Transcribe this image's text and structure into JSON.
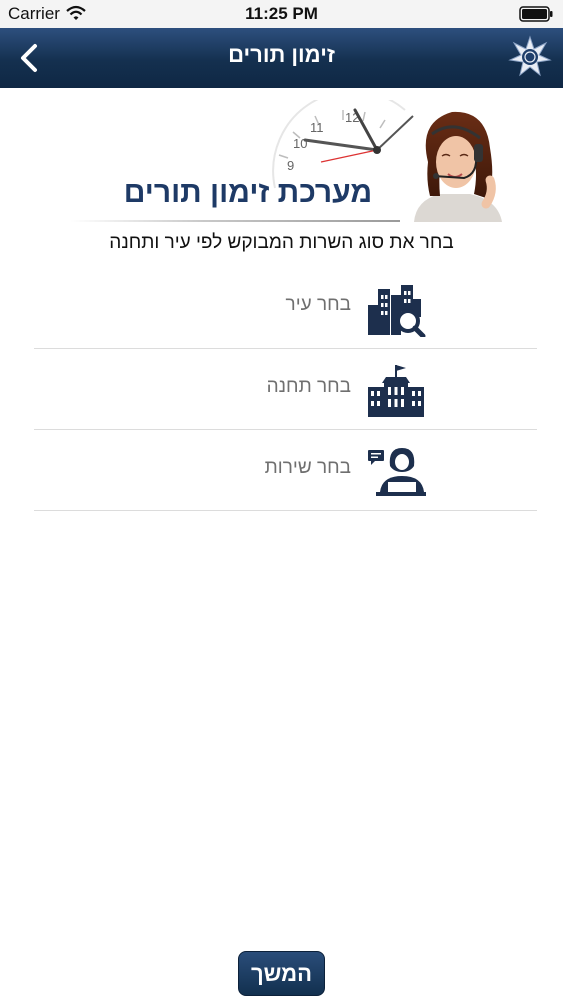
{
  "status_bar": {
    "carrier": "Carrier",
    "time": "11:25 PM"
  },
  "nav": {
    "title": "זימון תורים"
  },
  "banner": {
    "title": "מערכת זימון תורים",
    "clock_numbers": [
      "12",
      "11",
      "10",
      "9"
    ]
  },
  "instruction": "בחר את סוג השרות המבוקש לפי עיר ותחנה",
  "selectors": [
    {
      "label": "בחר עיר",
      "icon": "city-search-icon"
    },
    {
      "label": "בחר תחנה",
      "icon": "building-icon"
    },
    {
      "label": "בחר שירות",
      "icon": "service-agent-icon"
    }
  ],
  "continue_button": "המשך",
  "colors": {
    "nav_background": "#14304f",
    "title_blue": "#1e3a66",
    "icon_navy": "#1d2f4d",
    "label_gray": "#6f6f6f"
  }
}
